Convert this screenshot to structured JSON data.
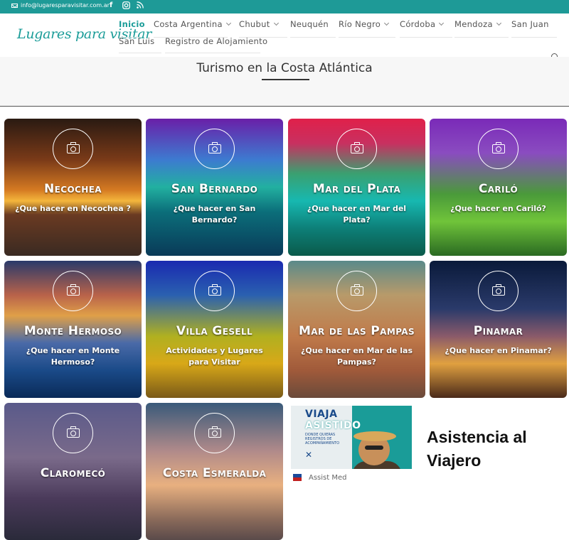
{
  "topbar": {
    "email": "info@lugaresparavisitar.com.ar",
    "social": [
      "facebook-icon",
      "instagram-icon",
      "rss-icon"
    ]
  },
  "header": {
    "logo": "Lugares para visitar",
    "nav": [
      {
        "label": "Inicio",
        "active": true,
        "dropdown": false
      },
      {
        "label": "Costa Argentina",
        "dropdown": true
      },
      {
        "label": "Chubut",
        "dropdown": true
      },
      {
        "label": "Neuquén",
        "dropdown": false
      },
      {
        "label": "Río Negro",
        "dropdown": true
      },
      {
        "label": "Córdoba",
        "dropdown": true
      },
      {
        "label": "Mendoza",
        "dropdown": true
      },
      {
        "label": "San Juan",
        "dropdown": false
      },
      {
        "label": "San Luis",
        "dropdown": false
      },
      {
        "label": "Registro de Alojamiento",
        "dropdown": false
      }
    ]
  },
  "section": {
    "title": "Turismo en la Costa Atlántica"
  },
  "cards": [
    {
      "title": "Necochea",
      "subtitle": "¿Que hacer en Necochea ?"
    },
    {
      "title": "San Bernardo",
      "subtitle": "¿Que hacer en San Bernardo?"
    },
    {
      "title": "Mar del Plata",
      "subtitle": "¿Que hacer en Mar del Plata?"
    },
    {
      "title": "Cariló",
      "subtitle": "¿Que hacer en Cariló?"
    },
    {
      "title": "Monte Hermoso",
      "subtitle": "¿Que hacer en Monte Hermoso?"
    },
    {
      "title": "Villa Gesell",
      "subtitle": "Actividades y Lugares para Visitar"
    },
    {
      "title": "Mar de las Pampas",
      "subtitle": "¿Que hacer en Mar de las Pampas?"
    },
    {
      "title": "Pinamar",
      "subtitle": "¿Que hacer en Pinamar?"
    },
    {
      "title": "Claromecó",
      "subtitle": ""
    },
    {
      "title": "Costa Esmeralda",
      "subtitle": ""
    }
  ],
  "ad": {
    "image_line1": "VIAJA",
    "image_line2": "ASISTIDO",
    "image_line3": "DONDE QUIERAS REGISTROS DE ACOMPAÑAMIENTO",
    "title": "Asistencia al Viajero",
    "footer": "Assist Med"
  },
  "colors": {
    "accent": "#1a9c98",
    "topbar": "#1e9a97"
  }
}
